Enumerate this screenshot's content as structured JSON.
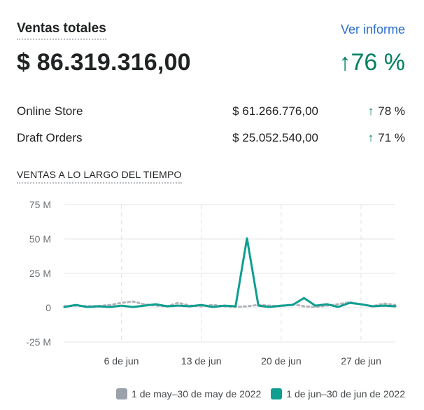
{
  "header": {
    "title": "Ventas totales",
    "report_link": "Ver informe",
    "total": "$ 86.319.316,00",
    "total_change": "76 %",
    "arrow": "↑"
  },
  "breakdown": [
    {
      "label": "Online Store",
      "amount": "$ 61.266.776,00",
      "change": "78 %"
    },
    {
      "label": "Draft Orders",
      "amount": "$ 25.052.540,00",
      "change": "71 %"
    }
  ],
  "section_title": "VENTAS A LO LARGO DEL TIEMPO",
  "colors": {
    "current": "#0f9e90",
    "previous": "#b1b5ba",
    "positive": "#008060",
    "link": "#2c6ecb"
  },
  "chart_data": {
    "type": "line",
    "ylim": [
      -25,
      75
    ],
    "yticks": [
      "75 M",
      "50 M",
      "25 M",
      "0",
      "-25 M"
    ],
    "ytick_values": [
      75,
      50,
      25,
      0,
      -25
    ],
    "xticks": [
      "6 de jun",
      "13 de jun",
      "20 de jun",
      "27 de jun"
    ],
    "xtick_days": [
      6,
      13,
      20,
      27
    ],
    "series": [
      {
        "name": "1 de may–30 de may de 2022",
        "style": "dotted",
        "x": [
          1,
          2,
          3,
          4,
          5,
          6,
          7,
          8,
          9,
          10,
          11,
          12,
          13,
          14,
          15,
          16,
          17,
          18,
          19,
          20,
          21,
          22,
          23,
          24,
          25,
          26,
          27,
          28,
          29,
          30
        ],
        "values": [
          1.0,
          1.5,
          1.0,
          1.2,
          2.0,
          3.5,
          4.5,
          2.5,
          1.5,
          1.0,
          3.5,
          1.5,
          1.0,
          2.0,
          1.0,
          0.5,
          1.0,
          2.0,
          1.5,
          1.0,
          2.5,
          1.0,
          0.5,
          1.5,
          2.5,
          4.0,
          2.5,
          1.0,
          3.0,
          2.0
        ]
      },
      {
        "name": "1 de jun–30 de jun de 2022",
        "style": "solid",
        "x": [
          1,
          2,
          3,
          4,
          5,
          6,
          7,
          8,
          9,
          10,
          11,
          12,
          13,
          14,
          15,
          16,
          17,
          18,
          19,
          20,
          21,
          22,
          23,
          24,
          25,
          26,
          27,
          28,
          29,
          30
        ],
        "values": [
          0.5,
          2.0,
          0.5,
          1.0,
          0.5,
          1.5,
          0.5,
          1.5,
          2.5,
          1.0,
          1.5,
          1.0,
          2.0,
          0.5,
          1.5,
          1.0,
          50.5,
          1.5,
          0.5,
          1.5,
          2.0,
          7.0,
          1.5,
          2.5,
          0.5,
          3.5,
          2.5,
          1.0,
          1.5,
          1.0
        ]
      }
    ],
    "legend_position": "bottom-right"
  }
}
